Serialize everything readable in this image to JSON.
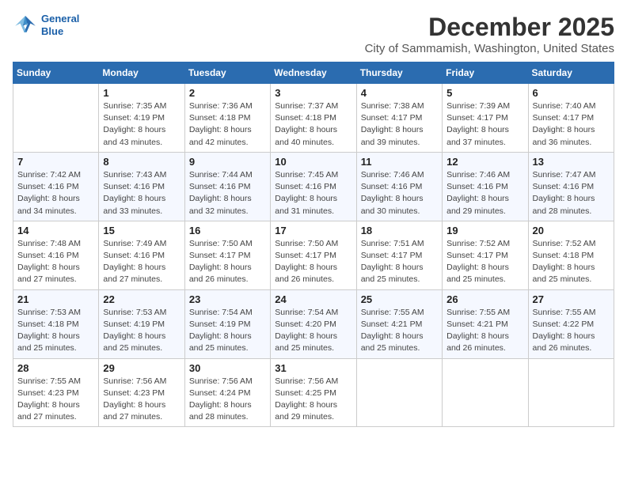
{
  "logo": {
    "line1": "General",
    "line2": "Blue"
  },
  "title": "December 2025",
  "location": "City of Sammamish, Washington, United States",
  "weekdays": [
    "Sunday",
    "Monday",
    "Tuesday",
    "Wednesday",
    "Thursday",
    "Friday",
    "Saturday"
  ],
  "weeks": [
    [
      {
        "day": "",
        "info": ""
      },
      {
        "day": "1",
        "info": "Sunrise: 7:35 AM\nSunset: 4:19 PM\nDaylight: 8 hours\nand 43 minutes."
      },
      {
        "day": "2",
        "info": "Sunrise: 7:36 AM\nSunset: 4:18 PM\nDaylight: 8 hours\nand 42 minutes."
      },
      {
        "day": "3",
        "info": "Sunrise: 7:37 AM\nSunset: 4:18 PM\nDaylight: 8 hours\nand 40 minutes."
      },
      {
        "day": "4",
        "info": "Sunrise: 7:38 AM\nSunset: 4:17 PM\nDaylight: 8 hours\nand 39 minutes."
      },
      {
        "day": "5",
        "info": "Sunrise: 7:39 AM\nSunset: 4:17 PM\nDaylight: 8 hours\nand 37 minutes."
      },
      {
        "day": "6",
        "info": "Sunrise: 7:40 AM\nSunset: 4:17 PM\nDaylight: 8 hours\nand 36 minutes."
      }
    ],
    [
      {
        "day": "7",
        "info": "Sunrise: 7:42 AM\nSunset: 4:16 PM\nDaylight: 8 hours\nand 34 minutes."
      },
      {
        "day": "8",
        "info": "Sunrise: 7:43 AM\nSunset: 4:16 PM\nDaylight: 8 hours\nand 33 minutes."
      },
      {
        "day": "9",
        "info": "Sunrise: 7:44 AM\nSunset: 4:16 PM\nDaylight: 8 hours\nand 32 minutes."
      },
      {
        "day": "10",
        "info": "Sunrise: 7:45 AM\nSunset: 4:16 PM\nDaylight: 8 hours\nand 31 minutes."
      },
      {
        "day": "11",
        "info": "Sunrise: 7:46 AM\nSunset: 4:16 PM\nDaylight: 8 hours\nand 30 minutes."
      },
      {
        "day": "12",
        "info": "Sunrise: 7:46 AM\nSunset: 4:16 PM\nDaylight: 8 hours\nand 29 minutes."
      },
      {
        "day": "13",
        "info": "Sunrise: 7:47 AM\nSunset: 4:16 PM\nDaylight: 8 hours\nand 28 minutes."
      }
    ],
    [
      {
        "day": "14",
        "info": "Sunrise: 7:48 AM\nSunset: 4:16 PM\nDaylight: 8 hours\nand 27 minutes."
      },
      {
        "day": "15",
        "info": "Sunrise: 7:49 AM\nSunset: 4:16 PM\nDaylight: 8 hours\nand 27 minutes."
      },
      {
        "day": "16",
        "info": "Sunrise: 7:50 AM\nSunset: 4:17 PM\nDaylight: 8 hours\nand 26 minutes."
      },
      {
        "day": "17",
        "info": "Sunrise: 7:50 AM\nSunset: 4:17 PM\nDaylight: 8 hours\nand 26 minutes."
      },
      {
        "day": "18",
        "info": "Sunrise: 7:51 AM\nSunset: 4:17 PM\nDaylight: 8 hours\nand 25 minutes."
      },
      {
        "day": "19",
        "info": "Sunrise: 7:52 AM\nSunset: 4:17 PM\nDaylight: 8 hours\nand 25 minutes."
      },
      {
        "day": "20",
        "info": "Sunrise: 7:52 AM\nSunset: 4:18 PM\nDaylight: 8 hours\nand 25 minutes."
      }
    ],
    [
      {
        "day": "21",
        "info": "Sunrise: 7:53 AM\nSunset: 4:18 PM\nDaylight: 8 hours\nand 25 minutes."
      },
      {
        "day": "22",
        "info": "Sunrise: 7:53 AM\nSunset: 4:19 PM\nDaylight: 8 hours\nand 25 minutes."
      },
      {
        "day": "23",
        "info": "Sunrise: 7:54 AM\nSunset: 4:19 PM\nDaylight: 8 hours\nand 25 minutes."
      },
      {
        "day": "24",
        "info": "Sunrise: 7:54 AM\nSunset: 4:20 PM\nDaylight: 8 hours\nand 25 minutes."
      },
      {
        "day": "25",
        "info": "Sunrise: 7:55 AM\nSunset: 4:21 PM\nDaylight: 8 hours\nand 25 minutes."
      },
      {
        "day": "26",
        "info": "Sunrise: 7:55 AM\nSunset: 4:21 PM\nDaylight: 8 hours\nand 26 minutes."
      },
      {
        "day": "27",
        "info": "Sunrise: 7:55 AM\nSunset: 4:22 PM\nDaylight: 8 hours\nand 26 minutes."
      }
    ],
    [
      {
        "day": "28",
        "info": "Sunrise: 7:55 AM\nSunset: 4:23 PM\nDaylight: 8 hours\nand 27 minutes."
      },
      {
        "day": "29",
        "info": "Sunrise: 7:56 AM\nSunset: 4:23 PM\nDaylight: 8 hours\nand 27 minutes."
      },
      {
        "day": "30",
        "info": "Sunrise: 7:56 AM\nSunset: 4:24 PM\nDaylight: 8 hours\nand 28 minutes."
      },
      {
        "day": "31",
        "info": "Sunrise: 7:56 AM\nSunset: 4:25 PM\nDaylight: 8 hours\nand 29 minutes."
      },
      {
        "day": "",
        "info": ""
      },
      {
        "day": "",
        "info": ""
      },
      {
        "day": "",
        "info": ""
      }
    ]
  ]
}
